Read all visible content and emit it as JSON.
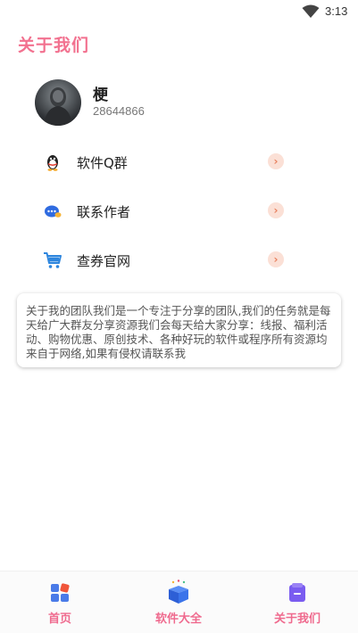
{
  "status_bar": {
    "time": "3:13",
    "wifi_icon": "wifi-icon"
  },
  "header": {
    "title": "关于我们"
  },
  "profile": {
    "name": "梗",
    "id": "28644866",
    "avatar_icon": "avatar"
  },
  "menu": {
    "items": [
      {
        "label": "软件Q群",
        "icon": "qq-penguin-icon"
      },
      {
        "label": "联系作者",
        "icon": "chat-bubble-icon"
      },
      {
        "label": "查券官网",
        "icon": "shopping-cart-icon"
      }
    ],
    "chevron": "›"
  },
  "description": {
    "text": "关于我的团队我们是一个专注于分享的团队,我们的任务就是每天给广大群友分享资源我们会每天给大家分享：线报、福利活动、购物优惠、原创技术、各种好玩的软件或程序所有资源均来自于网络,如果有侵权请联系我"
  },
  "bottom_nav": {
    "tabs": [
      {
        "label": "首页",
        "icon": "home-grid-icon"
      },
      {
        "label": "软件大全",
        "icon": "gift-box-icon"
      },
      {
        "label": "关于我们",
        "icon": "about-card-icon"
      }
    ],
    "active_color": "#ef6a8e"
  },
  "colors": {
    "accent": "#f2718f",
    "chevron_bg": "#fbe0d6",
    "chevron_fg": "#e8805e"
  }
}
